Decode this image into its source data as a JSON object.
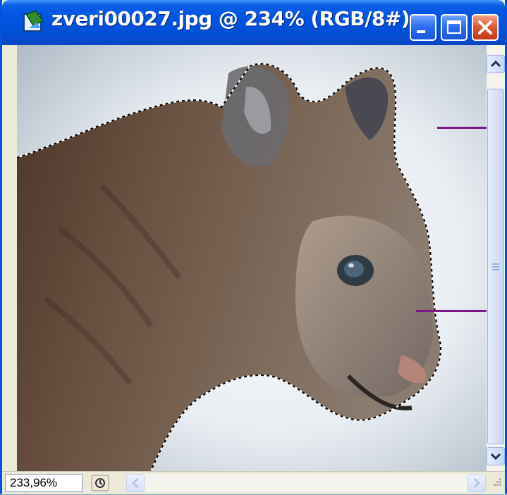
{
  "window": {
    "title": "zveri00027.jpg @ 234% (RGB/8#)",
    "app_icon": "photoshop-doc-icon",
    "buttons": {
      "minimize": "minimize-icon",
      "maximize": "maximize-icon",
      "close": "close-icon"
    }
  },
  "status": {
    "zoom": "233,96%",
    "arrow_icon": "status-menu-arrow-icon"
  },
  "scrollbars": {
    "up_icon": "chevron-up-icon",
    "down_icon": "chevron-down-icon",
    "left_icon": "chevron-left-icon",
    "right_icon": "chevron-right-icon"
  },
  "colors": {
    "titlebar": "#0054e3",
    "close": "#e0542f",
    "selection": "#000000",
    "callout": "#7a1a86"
  }
}
